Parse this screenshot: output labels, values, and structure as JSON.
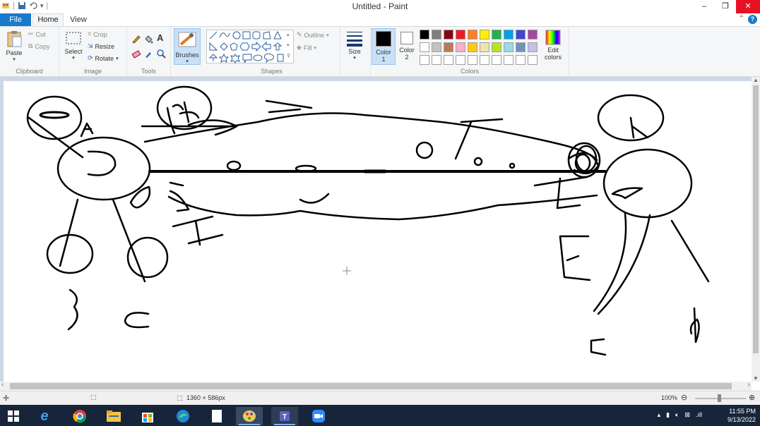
{
  "window": {
    "title": "Untitled - Paint",
    "minimize_icon": "minimize-icon",
    "restore_icon": "restore-icon",
    "close_icon": "close-icon"
  },
  "tabs": [
    {
      "label": "File"
    },
    {
      "label": "Home"
    },
    {
      "label": "View"
    }
  ],
  "ribbon": {
    "clipboard": {
      "label": "Clipboard",
      "paste": "Paste",
      "cut": "Cut",
      "copy": "Copy"
    },
    "image": {
      "label": "Image",
      "select": "Select",
      "crop": "Crop",
      "resize": "Resize",
      "rotate": "Rotate"
    },
    "tools": {
      "label": "Tools"
    },
    "brushes": {
      "label": "Brushes"
    },
    "shapes": {
      "label": "Shapes",
      "outline": "Outline",
      "fill": "Fill"
    },
    "size": {
      "label": "Size"
    },
    "colors": {
      "label": "Colors",
      "color1_label": "Color",
      "color1_num": "1",
      "color2_label": "Color",
      "color2_num": "2",
      "edit_label": "Edit",
      "edit_label2": "colors",
      "color1": "#000000",
      "color2": "#ffffff",
      "palette_row1": [
        "#000000",
        "#7f7f7f",
        "#880015",
        "#ed1c24",
        "#ff7f27",
        "#fff200",
        "#22b14c",
        "#00a2e8",
        "#3f48cc",
        "#a349a4"
      ],
      "palette_row2": [
        "#ffffff",
        "#c3c3c3",
        "#b97a57",
        "#ffaec9",
        "#ffc90e",
        "#efe4b0",
        "#b5e61d",
        "#99d9ea",
        "#7092be",
        "#c8bfe7"
      ],
      "palette_row3": [
        "#ffffff",
        "#ffffff",
        "#ffffff",
        "#ffffff",
        "#ffffff",
        "#ffffff",
        "#ffffff",
        "#ffffff",
        "#ffffff",
        "#ffffff"
      ]
    }
  },
  "status": {
    "dimensions": "1360 × 586px",
    "zoom": "100%"
  },
  "taskbar": {
    "time": "11:55 PM",
    "date": "9/13/2022"
  }
}
